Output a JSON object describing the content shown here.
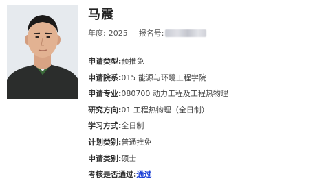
{
  "profile": {
    "name": "马震",
    "year_label": "年度:",
    "year_value": "2025",
    "reg_label": "报名号:"
  },
  "info": [
    {
      "label": "申请类型:",
      "value": "预推免"
    },
    {
      "label": "申请院系:",
      "value": "015 能源与环境工程学院"
    },
    {
      "label": "申请专业:",
      "value": "080700 动力工程及工程热物理"
    },
    {
      "label": "研究方向:",
      "value": "01 工程热物理（全日制）"
    },
    {
      "label": "学习方式:",
      "value": "全日制"
    },
    {
      "label": "计划类别:",
      "value": "普通推免"
    },
    {
      "label": "申请类别:",
      "value": "硕士"
    },
    {
      "label": "考核是否通过:",
      "value": "通过"
    }
  ],
  "colors": {
    "link": "#1a3fd6",
    "divider": "#e8eaee",
    "photo_bg": "#e4e8ec"
  }
}
